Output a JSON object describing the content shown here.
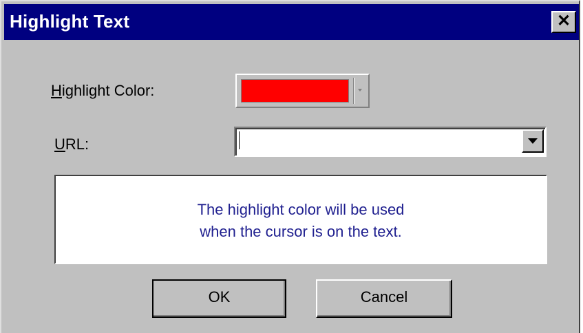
{
  "dialog": {
    "title": "Highlight Text",
    "close_label": "✕"
  },
  "highlight_color": {
    "label_mnemonic": "H",
    "label_rest": "ighlight Color:",
    "value": "#ff0000"
  },
  "url": {
    "label_mnemonic": "U",
    "label_rest": "RL:",
    "value": "",
    "placeholder": ""
  },
  "info": {
    "line1": "The highlight color will be used",
    "line2": "when the cursor is on the text."
  },
  "buttons": {
    "ok": "OK",
    "cancel": "Cancel"
  },
  "colors": {
    "titlebar": "#000080",
    "dialog_face": "#c0c0c0",
    "info_text": "#1f1f8f"
  }
}
